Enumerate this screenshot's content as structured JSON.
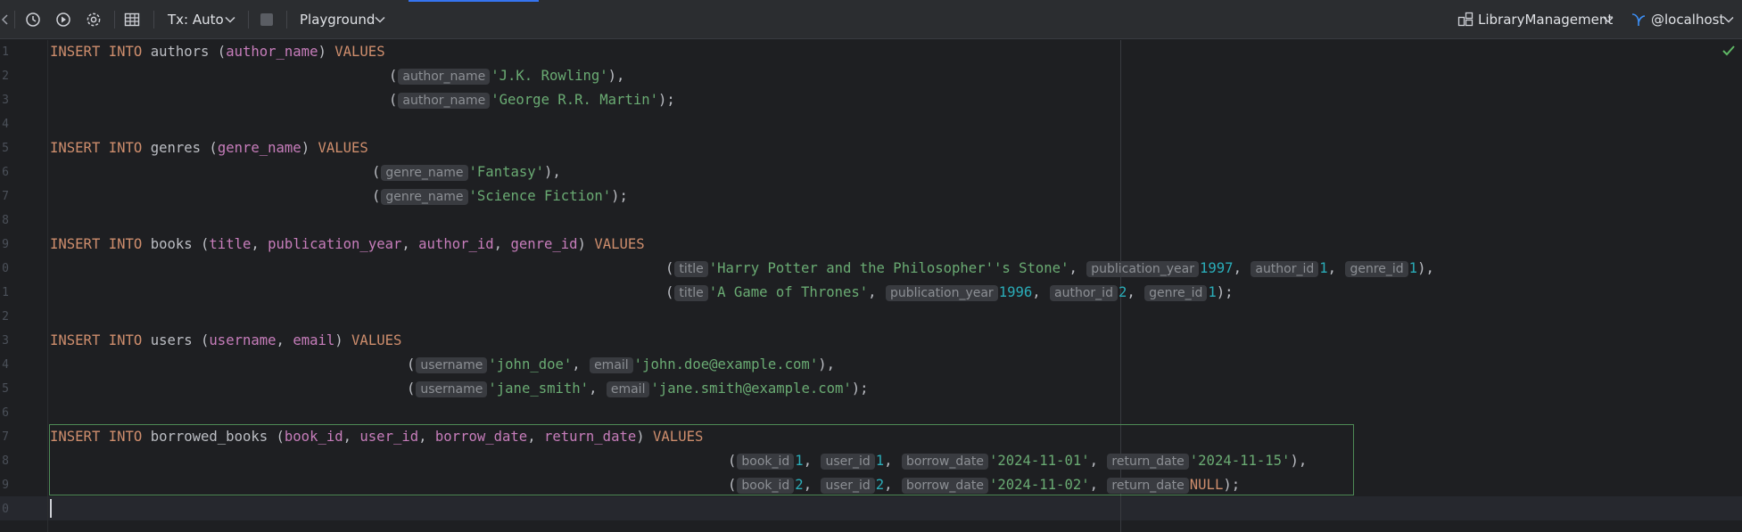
{
  "toolbar": {
    "tx_label": "Tx: Auto",
    "session_label": "Playground",
    "schema_label": "LibraryManagement",
    "host_label": "@localhost"
  },
  "editor": {
    "line_numbers": [
      "1",
      "2",
      "3",
      "4",
      "5",
      "6",
      "7",
      "8",
      "9",
      "0",
      "1",
      "2",
      "3",
      "4",
      "5",
      "6",
      "7",
      "8",
      "9",
      "0"
    ],
    "hints": {
      "author_name": "author_name",
      "genre_name": "genre_name",
      "title": "title",
      "publication_year": "publication_year",
      "author_id": "author_id",
      "genre_id": "genre_id",
      "username": "username",
      "email": "email",
      "book_id": "book_id",
      "user_id": "user_id",
      "borrow_date": "borrow_date",
      "return_date": "return_date"
    },
    "code": {
      "insert": "INSERT",
      "into": "INTO",
      "values_kw": "VALUES",
      "null_kw": "NULL",
      "t_authors": "authors",
      "t_genres": "genres",
      "t_books": "books",
      "t_users": "users",
      "t_borrowed": "borrowed_books",
      "c_author_name": "author_name",
      "c_genre_name": "genre_name",
      "c_title": "title",
      "c_publication_year": "publication_year",
      "c_author_id": "author_id",
      "c_genre_id": "genre_id",
      "c_username": "username",
      "c_email": "email",
      "c_book_id": "book_id",
      "c_user_id": "user_id",
      "c_borrow_date": "borrow_date",
      "c_return_date": "return_date",
      "s_rowling": "'J.K. Rowling'",
      "s_martin": "'George R.R. Martin'",
      "s_fantasy": "'Fantasy'",
      "s_scifi": "'Science Fiction'",
      "s_hp": "'Harry Potter and the Philosopher''s Stone'",
      "s_got": "'A Game of Thrones'",
      "s_john": "'john_doe'",
      "s_john_email": "'john.doe@example.com'",
      "s_jane": "'jane_smith'",
      "s_jane_email": "'jane.smith@example.com'",
      "s_d1": "'2024-11-01'",
      "s_d2": "'2024-11-15'",
      "s_d3": "'2024-11-02'",
      "n_1997": "1997",
      "n_1996": "1996",
      "n_1": "1",
      "n_2": "2"
    }
  },
  "colors": {
    "keyword": "#cf8e6d",
    "column": "#c77dbb",
    "string": "#6aab73",
    "number": "#2aacb8",
    "accent": "#3574f0",
    "ok": "#5fb865"
  },
  "icons": [
    "history-icon",
    "run-icon",
    "settings-icon",
    "table-icon",
    "chevron-down-icon",
    "stop-icon",
    "schema-icon",
    "datasource-icon",
    "check-icon"
  ]
}
